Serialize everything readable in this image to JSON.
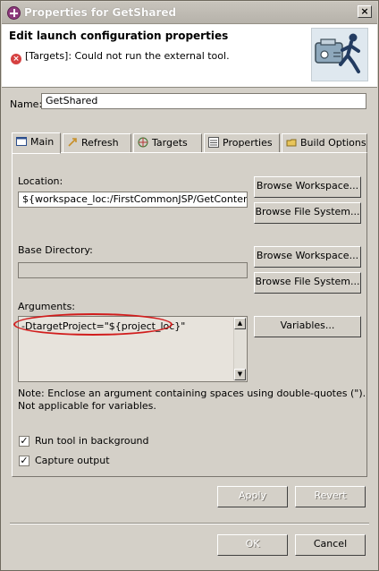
{
  "window": {
    "title": "Properties for GetShared",
    "close_glyph": "×"
  },
  "banner": {
    "title": "Edit launch configuration properties",
    "error_icon": "×",
    "error_text": "[Targets]: Could not run the external tool."
  },
  "name": {
    "label": "Name:",
    "value": "GetShared"
  },
  "tabs": [
    {
      "label": "Main",
      "icon": "main-icon",
      "active": true
    },
    {
      "label": "Refresh",
      "icon": "refresh-icon",
      "active": false
    },
    {
      "label": "Targets",
      "icon": "targets-icon",
      "active": false
    },
    {
      "label": "Properties",
      "icon": "properties-icon",
      "active": false
    },
    {
      "label": "Build Options",
      "icon": "build-options-icon",
      "active": false
    }
  ],
  "location": {
    "label": "Location:",
    "value": "${workspace_loc:/FirstCommonJSP/GetContent.x",
    "browse_workspace": "Browse Workspace...",
    "browse_file_system": "Browse File System..."
  },
  "base_directory": {
    "label": "Base Directory:",
    "value": "",
    "browse_workspace": "Browse Workspace...",
    "browse_file_system": "Browse File System..."
  },
  "arguments": {
    "label": "Arguments:",
    "value": "-DtargetProject=\"${project_loc}\"",
    "variables_button": "Variables..."
  },
  "note": {
    "line1": "Note: Enclose an argument containing spaces using double-quotes (\").",
    "line2": "Not applicable for variables."
  },
  "options": {
    "run_in_background": {
      "label": "Run tool in background",
      "checked": true
    },
    "capture_output": {
      "label": "Capture output",
      "checked": true
    }
  },
  "buttons": {
    "apply": "Apply",
    "revert": "Revert",
    "ok": "OK",
    "cancel": "Cancel"
  },
  "colors": {
    "dialog_bg": "#d4d0c8",
    "highlight_red": "#d11d1d",
    "title_icon": "#8e3a7d"
  }
}
